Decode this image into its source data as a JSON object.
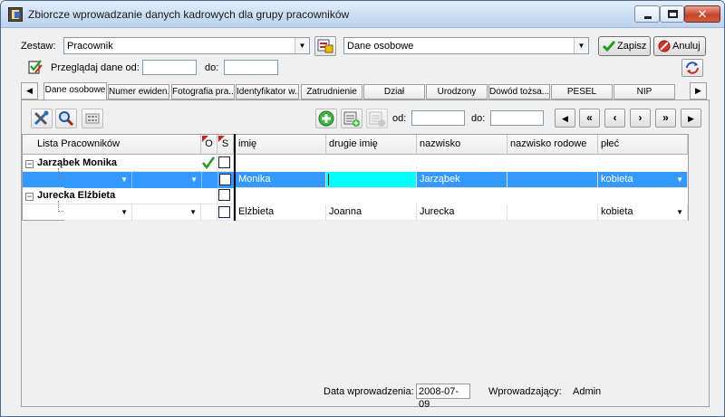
{
  "window": {
    "title": "Zbiorcze wprowadzanie danych kadrowych dla grupy pracowników"
  },
  "controls": {
    "min": "–",
    "max": "□",
    "close": "✕"
  },
  "zestaw": {
    "label": "Zestaw:",
    "value": "Pracownik",
    "second_value": "Dane osobowe"
  },
  "buttons": {
    "save": "Zapisz",
    "cancel": "Anuluj"
  },
  "browse": {
    "label": "Przeglądaj dane od:",
    "from_value": "",
    "to_label": "do:",
    "to_value": ""
  },
  "tabs": [
    "Dane osobowe",
    "Numer ewiden...",
    "Fotografia pra...",
    "Identyfikator w...",
    "Zatrudnienie",
    "Dział",
    "Urodzony",
    "Dowód tożsa...",
    "PESEL",
    "NIP"
  ],
  "toolbar": {
    "from_label": "od:",
    "to_label": "do:",
    "from_value": "",
    "to_value": ""
  },
  "nav": {
    "first": "|◀",
    "prev_page": "◀◀",
    "prev": "◀",
    "next": "▶",
    "next_page": "▶▶",
    "last": "▶|"
  },
  "grid": {
    "columns": {
      "list": "Lista Pracowników",
      "o": "O",
      "s": "S",
      "imie": "imię",
      "drugie_imie": "drugie imię",
      "nazwisko": "nazwisko",
      "nazwisko_rodowe": "nazwisko rodowe",
      "plec": "płeć"
    },
    "groups": [
      {
        "name": "Jarząbek Monika",
        "row": {
          "imie": "Monika",
          "drugie_imie": "",
          "nazwisko": "Jarząbek",
          "nazwisko_rodowe": "",
          "plec": "kobieta"
        }
      },
      {
        "name": "Jurecka Elżbieta",
        "row": {
          "imie": "Elżbieta",
          "drugie_imie": "Joanna",
          "nazwisko": "Jurecka",
          "nazwisko_rodowe": "",
          "plec": "kobieta"
        }
      }
    ]
  },
  "status": {
    "date_label": "Data wprowadzenia:",
    "date_value": "2008-07-09",
    "entered_by_label": "Wprowadzający:",
    "entered_by_value": "Admin"
  }
}
